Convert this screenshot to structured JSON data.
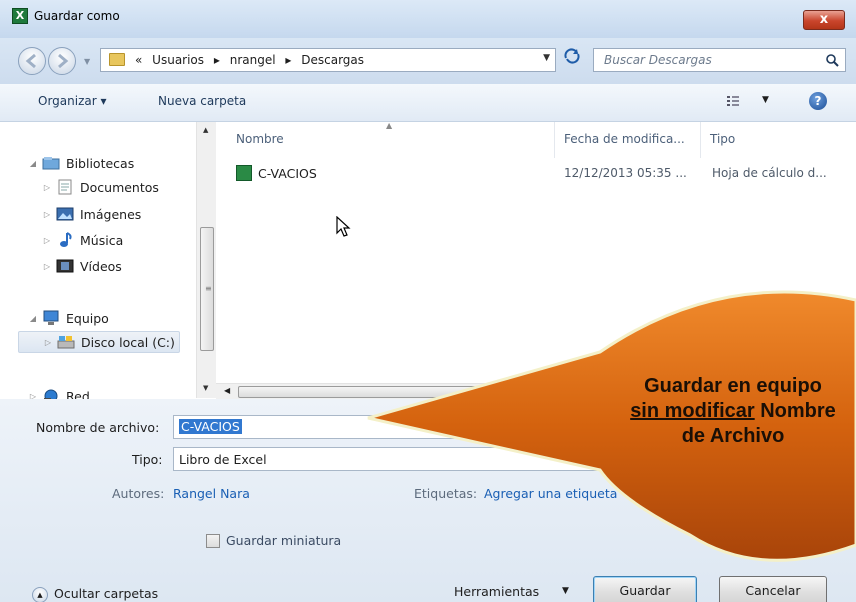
{
  "window": {
    "title": "Guardar como",
    "close_glyph": "x"
  },
  "address": {
    "prefix": "«",
    "path": [
      "Usuarios",
      "nrangel",
      "Descargas"
    ],
    "separator": "▸"
  },
  "search": {
    "placeholder": "Buscar Descargas"
  },
  "toolbar": {
    "organize": "Organizar ▾",
    "new_folder": "Nueva carpeta"
  },
  "tree": {
    "libraries": "Bibliotecas",
    "documents": "Documentos",
    "images": "Imágenes",
    "music": "Música",
    "videos": "Vídeos",
    "computer": "Equipo",
    "local_disk": "Disco local (C:)",
    "network": "Red"
  },
  "columns": {
    "name": "Nombre",
    "date": "Fecha de modifica...",
    "type": "Tipo"
  },
  "files": [
    {
      "name": "C-VACIOS",
      "date": "12/12/2013 05:35 ...",
      "type": "Hoja de cálculo d..."
    }
  ],
  "form": {
    "filename_label": "Nombre de archivo:",
    "filename_value": "C-VACIOS",
    "type_label": "Tipo:",
    "type_value": "Libro de Excel",
    "authors_label": "Autores:",
    "authors_value": "Rangel Nara",
    "tags_label": "Etiquetas:",
    "tags_value": "Agregar una etiqueta",
    "thumbnail_label": "Guardar miniatura"
  },
  "footer": {
    "hide_folders": "Ocultar carpetas",
    "tools": "Herramientas",
    "save": "Guardar",
    "cancel": "Cancelar"
  },
  "callout": {
    "line1": "Guardar en equipo",
    "line2_underlined": "sin modificar",
    "line2_rest": " Nombre",
    "line3": "de Archivo",
    "fill_color": "#d4620e"
  }
}
